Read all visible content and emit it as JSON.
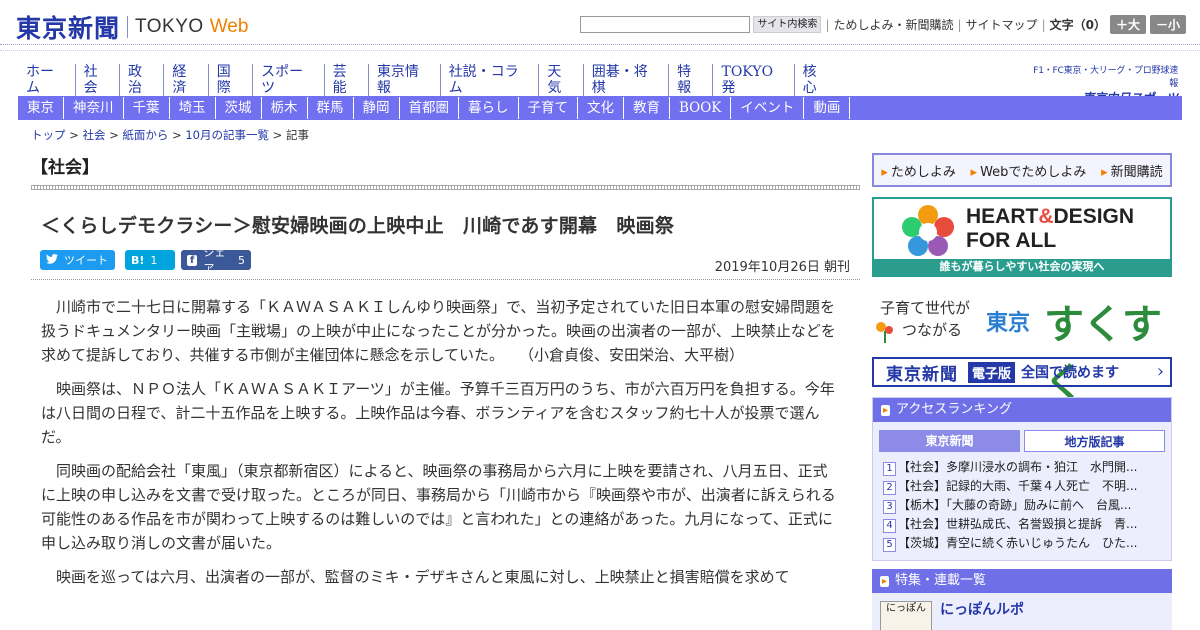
{
  "header": {
    "logo_jp": "東京新聞",
    "logo_en": "TOKYO",
    "logo_web": "Web",
    "search_placeholder": "",
    "search_button": "サイト内検索",
    "links": [
      "ためしよみ・新聞購読",
      "サイトマップ"
    ],
    "font_size_label": "文字（0）",
    "font_plus": "＋大",
    "font_minus": "－小"
  },
  "main_nav": [
    "ホーム",
    "社会",
    "政治",
    "経済",
    "国際",
    "スポーツ",
    "芸能",
    "東京情報",
    "社説・コラム",
    "天気",
    "囲碁・将棋",
    "特報",
    "TOKYO発",
    "核心"
  ],
  "sports_banner": {
    "top": "F1・FC東京・大リーグ・プロ野球速報",
    "main": "東京中日スポーツ"
  },
  "sub_nav": [
    "東京",
    "神奈川",
    "千葉",
    "埼玉",
    "茨城",
    "栃木",
    "群馬",
    "静岡",
    "首都圏",
    "暮らし",
    "子育て",
    "文化",
    "教育",
    "BOOK",
    "イベント",
    "動画"
  ],
  "breadcrumb": [
    "トップ",
    "社会",
    "紙面から",
    "10月の記事一覧",
    "記事"
  ],
  "article": {
    "section": "【社会】",
    "headline": "＜くらしデモクラシー＞慰安婦映画の上映中止　川崎であす開幕　映画祭",
    "tweet_label": "ツイート",
    "hatena_count": "1",
    "share_label": "シェア",
    "share_count": "5",
    "date": "2019年10月26日 朝刊",
    "paragraphs": [
      "川崎市で二十七日に開幕する「ＫＡＷＡＳＡＫＩしんゆり映画祭」で、当初予定されていた旧日本軍の慰安婦問題を扱うドキュメンタリー映画「主戦場」の上映が中止になったことが分かった。映画の出演者の一部が、上映禁止などを求めて提訴しており、共催する市側が主催団体に懸念を示していた。　　（小倉貞俊、安田栄治、大平樹）",
      "映画祭は、ＮＰＯ法人「ＫＡＷＡＳＡＫＩアーツ」が主催。予算千三百万円のうち、市が六百万円を負担する。今年は八日間の日程で、計二十五作品を上映する。上映作品は今春、ボランティアを含むスタッフ約七十人が投票で選んだ。",
      "同映画の配給会社「東風」（東京都新宿区）によると、映画祭の事務局から六月に上映を要請され、八月五日、正式に上映の申し込みを文書で受け取った。ところが同日、事務局から「川崎市から『映画祭や市が、出演者に訴えられる可能性のある作品を市が関わって上映するのは難しいのでは』と言われた」との連絡があった。九月になって、正式に申し込み取り消しの文書が届いた。",
      "映画を巡っては六月、出演者の一部が、監督のミキ・デザキさんと東風に対し、上映禁止と損害賠償を求めて"
    ]
  },
  "sidebar": {
    "trial_links": [
      "ためしよみ",
      "Webでためしよみ",
      "新聞購読"
    ],
    "heart_title_1": "HEART",
    "heart_amp": "&",
    "heart_title_2": "DESIGN",
    "heart_title_3": "FOR ALL",
    "heart_foot": "誰もが暮らしやすい社会の実現へ",
    "suku_small_1": "子育て世代が",
    "suku_small_2": "つながる",
    "suku_tokyo": "東京",
    "suku_big": "すくすく",
    "edition_logo": "東京新聞",
    "edition_badge": "電子版",
    "edition_text": "全国で読めます",
    "ranking_title": "アクセスランキング",
    "ranking_tabs": [
      "東京新聞",
      "地方版記事"
    ],
    "ranking": [
      {
        "num": "1",
        "text": "【社会】多摩川浸水の調布・狛江　水門開..."
      },
      {
        "num": "2",
        "text": "【社会】記録的大雨、千葉４人死亡　不明..."
      },
      {
        "num": "3",
        "text": "【栃木】「大藤の奇跡」励みに前へ　台風..."
      },
      {
        "num": "4",
        "text": "【社会】世耕弘成氏、名誉毀損と提訴　青..."
      },
      {
        "num": "5",
        "text": "【茨城】青空に続く赤いじゅうたん　ひた..."
      }
    ],
    "feature_title": "特集・連載一覧",
    "feature_thumb": "にっぽん",
    "feature_item": "にっぽんルポ"
  }
}
